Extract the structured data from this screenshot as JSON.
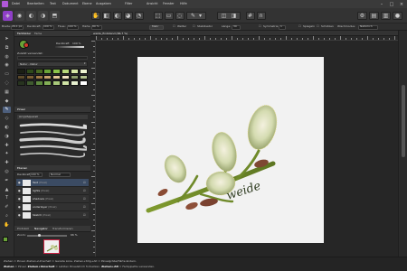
{
  "menubar": {
    "items": [
      "Datei",
      "Bearbeiten",
      "Text",
      "Dokument",
      "Ebene",
      "Ausgaben",
      "Filter",
      "Ansicht",
      "Fenster",
      "Hilfe"
    ]
  },
  "contextbar": {
    "width_label": "Breite:",
    "width_value": "26,1 px",
    "opacity_label": "Deckkraft:",
    "opacity_value": "100 %",
    "flow_label": "Fluss:",
    "flow_value": "100 %",
    "hardness_label": "Härte:",
    "hardness_value": "80 %",
    "more_label": "Mehr",
    "mode_label": "Wetter",
    "stabilizer_label": "Stabilisator",
    "length_label": "Länge:",
    "length_value": "30",
    "symmetry_label": "Symmetrie",
    "symmetry_value": "1",
    "mirror_label": "Spiegeln",
    "protect_label": "Schützen",
    "wrap_label": "Wischmodus:",
    "wrap_value": "Natürlich"
  },
  "document_tab": {
    "title": "weide_Endstand (66,7 %)"
  },
  "color_panel": {
    "tabs": [
      "Farbfelder",
      "Farbe"
    ],
    "opacity_label": "Deckkraft",
    "opacity_value": "100 %",
    "recent_label": "Zuletzt verwendet:",
    "palette_name": "Natur - Natur",
    "fg_color": "#6aa438",
    "bg_color": "#ffffff"
  },
  "brush_panel": {
    "tabs": [
      "Pinsel"
    ],
    "category_label": "Acryl/Aquarell"
  },
  "layers_panel": {
    "tabs": [
      "Ebenen"
    ],
    "opacity_label": "Deckkraft:",
    "opacity_value": "100 %",
    "blend_value": "Normal",
    "layers": [
      {
        "name": "Text",
        "tag": "(Pixel)"
      },
      {
        "name": "lights",
        "tag": "(Pixel)"
      },
      {
        "name": "shadows",
        "tag": "(Pixel)"
      },
      {
        "name": "underlayer",
        "tag": "(Pixel)"
      },
      {
        "name": "Sketch",
        "tag": "(Pixel)"
      }
    ]
  },
  "nav_panel": {
    "tabs": [
      "Protokoll",
      "Navigator",
      "Transformieren"
    ],
    "zoom_label": "Zoom:",
    "zoom_value": "66 %"
  },
  "statusbar": {
    "line1": "Ziehen = Pinsel. Ziehen+Umschalt = Gerade Linie. Ziehen+Strg+Alt = Pinselgröße/Härte ändern.",
    "line2_a": "Ziehen",
    "line2_b": " = Pinsel. ",
    "line2_c": "Ziehen+Umschalt",
    "line2_d": " = Letzten Pinselstrich fortsetzen. ",
    "line2_e": "Ziehen+Alt",
    "line2_f": " = Farbpipette verwenden."
  },
  "artwork": {
    "text": "weide"
  },
  "colors": {
    "accent": "#6aa438",
    "swatches": [
      "#1b1f14",
      "#2f4a1b",
      "#496b23",
      "#6aa438",
      "#8bc34a",
      "#b6d77a",
      "#d7e7a6",
      "#eef4d2",
      "#5c4a2a",
      "#7b5e33",
      "#a07a45",
      "#c7a36c",
      "#e3c896",
      "#f1e3c2",
      "#8a9a6a",
      "#b4c38f",
      "#27331f",
      "#3f5a2f",
      "#5f8a3f",
      "#84b057",
      "#a8c97a",
      "#cfe2a5",
      "#e6efcf",
      "#ffffff"
    ]
  }
}
